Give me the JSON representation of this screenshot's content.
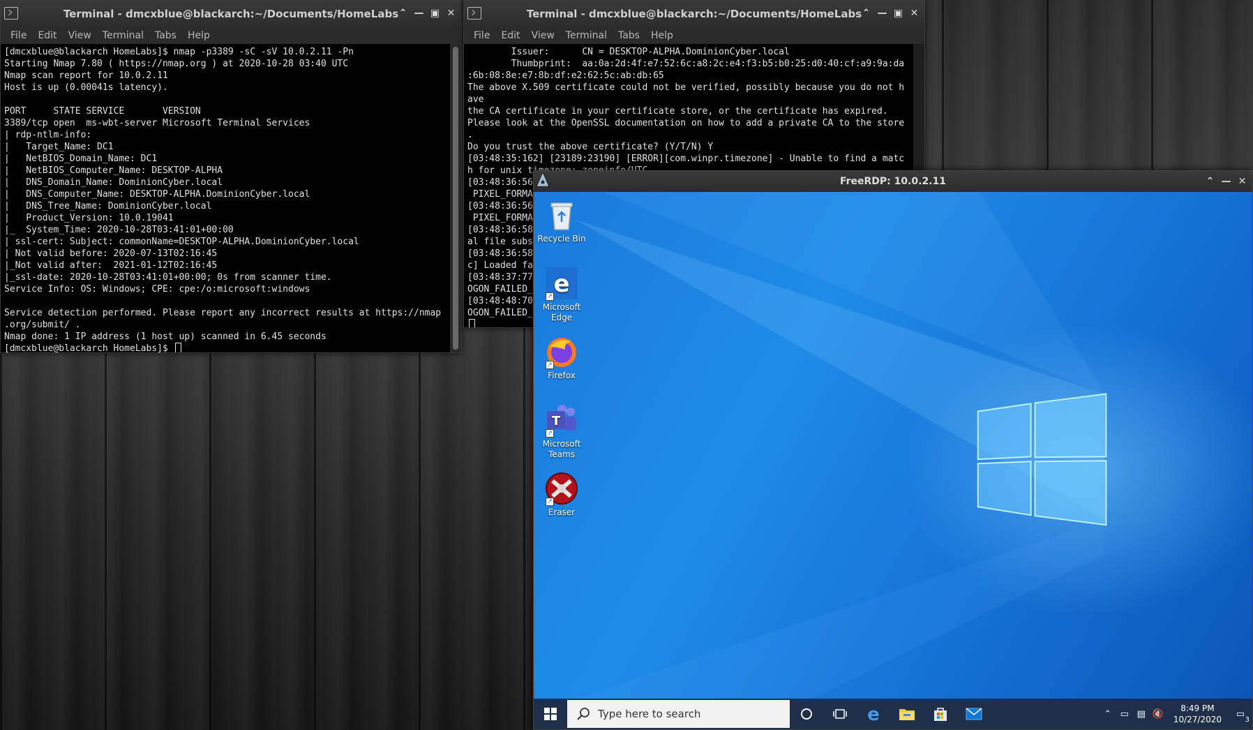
{
  "menu": [
    "File",
    "Edit",
    "View",
    "Terminal",
    "Tabs",
    "Help"
  ],
  "terminal1": {
    "title": "Terminal - dmcxblue@blackarch:~/Documents/HomeLabs",
    "lines": [
      "[dmcxblue@blackarch HomeLabs]$ nmap -p3389 -sC -sV 10.0.2.11 -Pn",
      "Starting Nmap 7.80 ( https://nmap.org ) at 2020-10-28 03:40 UTC",
      "Nmap scan report for 10.0.2.11",
      "Host is up (0.00041s latency).",
      "",
      "PORT     STATE SERVICE       VERSION",
      "3389/tcp open  ms-wbt-server Microsoft Terminal Services",
      "| rdp-ntlm-info:",
      "|   Target_Name: DC1",
      "|   NetBIOS_Domain_Name: DC1",
      "|   NetBIOS_Computer_Name: DESKTOP-ALPHA",
      "|   DNS_Domain_Name: DominionCyber.local",
      "|   DNS_Computer_Name: DESKTOP-ALPHA.DominionCyber.local",
      "|   DNS_Tree_Name: DominionCyber.local",
      "|   Product_Version: 10.0.19041",
      "|_  System_Time: 2020-10-28T03:41:01+00:00",
      "| ssl-cert: Subject: commonName=DESKTOP-ALPHA.DominionCyber.local",
      "| Not valid before: 2020-07-13T02:16:45",
      "|_Not valid after:  2021-01-12T02:16:45",
      "|_ssl-date: 2020-10-28T03:41:01+00:00; 0s from scanner time.",
      "Service Info: OS: Windows; CPE: cpe:/o:microsoft:windows",
      "",
      "Service detection performed. Please report any incorrect results at https://nmap",
      ".org/submit/ .",
      "Nmap done: 1 IP address (1 host up) scanned in 6.45 seconds"
    ],
    "prompt": "[dmcxblue@blackarch HomeLabs]$ "
  },
  "terminal2": {
    "title": "Terminal - dmcxblue@blackarch:~/Documents/HomeLabs",
    "lines": [
      "        Issuer:      CN = DESKTOP-ALPHA.DominionCyber.local",
      "        Thumbprint:  aa:0a:2d:4f:e7:52:6c:a8:2c:e4:f3:b5:b0:25:d0:40:cf:a9:9a:da",
      ":6b:08:8e:e7:8b:df:e2:62:5c:ab:db:65",
      "The above X.509 certificate could not be verified, possibly because you do not h",
      "ave",
      "the CA certificate in your certificate store, or the certificate has expired.",
      "Please look at the OpenSSL documentation on how to add a private CA to the store",
      ".",
      "Do you trust the above certificate? (Y/T/N) Y",
      "[03:48:35:162] [23189:23190] [ERROR][com.winpr.timezone] - Unable to find a matc",
      "h for unix timezone: zoneinfo/UTC",
      "[03:48:36:56",
      " PIXEL_FORMA",
      "[03:48:36:56",
      " PIXEL_FORMA",
      "[03:48:36:58",
      "al file subs",
      "[03:48:36:58",
      "c] Loaded fa",
      "[03:48:37:77",
      "OGON_FAILED_",
      "[03:48:48:70",
      "OGON_FAILED_"
    ]
  },
  "rdp": {
    "title": "FreeRDP: 10.0.2.11",
    "icons": [
      {
        "label": "Recycle Bin",
        "name": "recycle-bin-icon"
      },
      {
        "label": "Microsoft Edge",
        "name": "edge-icon"
      },
      {
        "label": "Firefox",
        "name": "firefox-icon"
      },
      {
        "label": "Microsoft Teams",
        "name": "teams-icon"
      },
      {
        "label": "Eraser",
        "name": "eraser-icon"
      }
    ],
    "taskbar": {
      "search_placeholder": "Type here to search",
      "time": "8:49 PM",
      "date": "10/27/2020",
      "notification_count": "3"
    }
  }
}
